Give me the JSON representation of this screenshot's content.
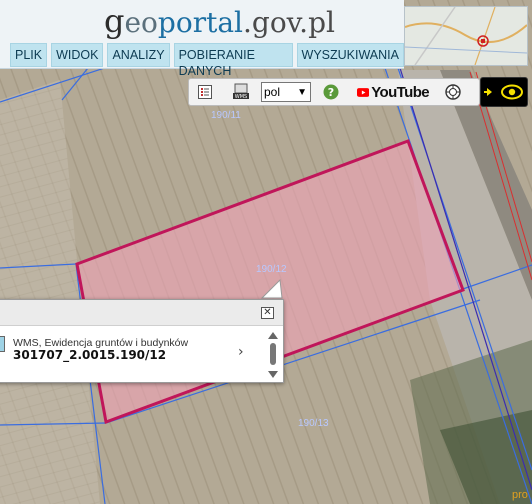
{
  "logo": {
    "g": "g",
    "eo": "eo",
    "portal": "portal",
    "dom": ".gov.pl"
  },
  "menu": [
    {
      "label": "PLIK"
    },
    {
      "label": "WIDOK"
    },
    {
      "label": "ANALIZY"
    },
    {
      "label": "POBIERANIE DANYCH"
    },
    {
      "label": "WYSZUKIWANIA"
    }
  ],
  "toolbar": {
    "list_icon": "list-icon",
    "wms_icon": "wms-icon",
    "language_value": "pol",
    "help_icon": "question-icon",
    "youtube_label": "YouTube",
    "compass_icon": "compass-icon",
    "eye_icon": "eye-icon"
  },
  "parcels": {
    "top": "190/11",
    "selected": "190/12",
    "bottom": "190/13"
  },
  "popup": {
    "source": "WMS, Ewidencja gruntów i budynków",
    "parcel_id": "301707_2.0015.190/12",
    "close_icon": "close-icon"
  },
  "corner": "pro",
  "colors": {
    "parcel_fill": "#f0a3b8",
    "parcel_border": "#c0165a",
    "menu_bg": "#bfe3ef",
    "boundary_line": "#3a6de0"
  }
}
